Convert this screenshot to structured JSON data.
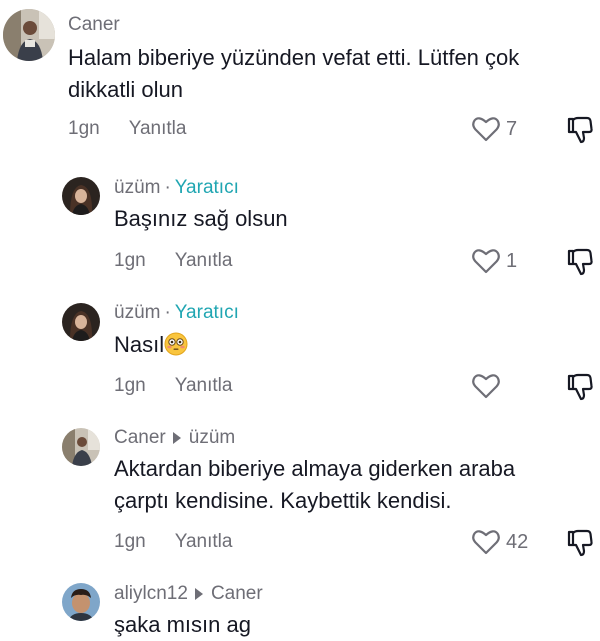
{
  "comments": [
    {
      "author": "Caner",
      "text_lines": [
        "Halam biberiye yüzünden vefat etti. Lütfen çok",
        "dikkatli olun"
      ],
      "time": "1gn",
      "reply_label": "Yanıtla",
      "likes": "7"
    },
    {
      "author": "üzüm",
      "separator": "·",
      "creator_label": "Yaratıcı",
      "text": "Başınız sağ olsun",
      "time": "1gn",
      "reply_label": "Yanıtla",
      "likes": "1"
    },
    {
      "author": "üzüm",
      "separator": "·",
      "creator_label": "Yaratıcı",
      "text": "Nasıl",
      "emoji": "flushed-face",
      "time": "1gn",
      "reply_label": "Yanıtla",
      "likes": ""
    },
    {
      "author": "Caner",
      "reply_to": "üzüm",
      "text_lines": [
        "Aktardan biberiye almaya giderken araba",
        "çarptı kendisine. Kaybettik kendisi."
      ],
      "time": "1gn",
      "reply_label": "Yanıtla",
      "likes": "42"
    },
    {
      "author": "aliylcn12",
      "reply_to": "Caner",
      "text": "şaka mısın ag"
    }
  ],
  "icons": {
    "like": "heart-outline-icon",
    "dislike": "thumbs-down-outline-icon",
    "reply_arrow": "triangle-right-icon"
  },
  "colors": {
    "text_primary": "#161823",
    "text_secondary": "#6e6e76",
    "creator_accent": "#20a6b2"
  }
}
